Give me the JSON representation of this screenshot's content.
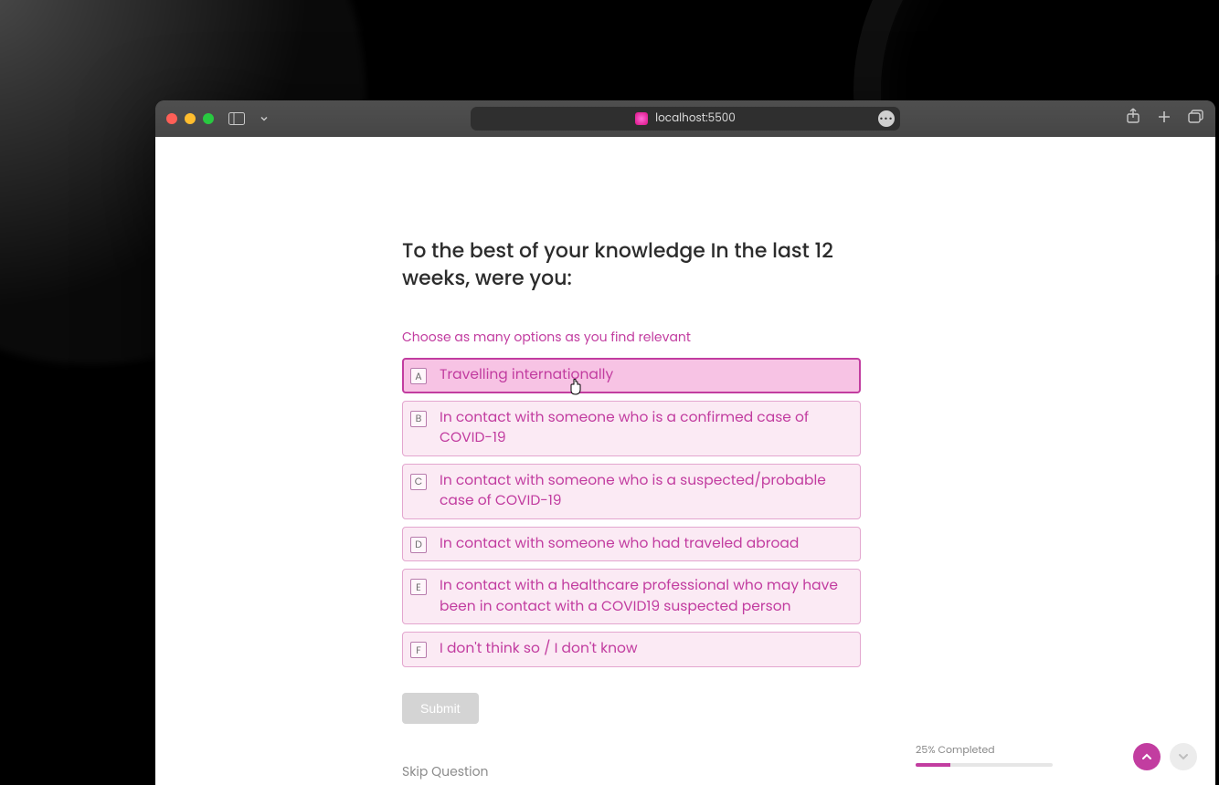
{
  "browser": {
    "address": "localhost:5500"
  },
  "question": {
    "title": "To the best of your knowledge In the last 12 weeks, were you:",
    "instruction": "Choose as many options as you find relevant",
    "options": [
      {
        "key": "A",
        "label": "Travelling internationally",
        "selected": true
      },
      {
        "key": "B",
        "label": "In contact with someone who is a confirmed case of COVID-19",
        "selected": false
      },
      {
        "key": "C",
        "label": "In contact with someone who is a suspected/probable case of COVID-19",
        "selected": false
      },
      {
        "key": "D",
        "label": "In contact with someone who had traveled abroad",
        "selected": false
      },
      {
        "key": "E",
        "label": "In contact with a healthcare professional who may have been in contact with a COVID19 suspected person",
        "selected": false
      },
      {
        "key": "F",
        "label": "I don't think so / I don't know",
        "selected": false
      }
    ],
    "submit_label": "Submit",
    "skip_label": "Skip Question"
  },
  "progress": {
    "percent": 25,
    "label": "25% Completed"
  }
}
